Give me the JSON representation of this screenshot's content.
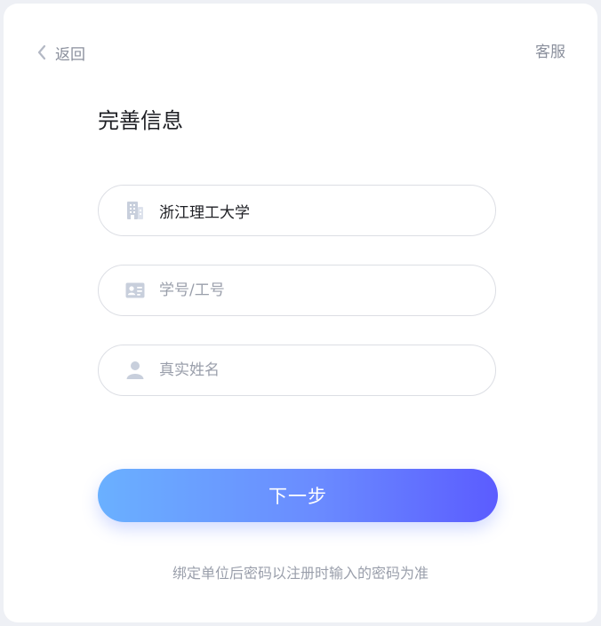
{
  "header": {
    "back_label": "返回",
    "service_label": "客服"
  },
  "page": {
    "title": "完善信息"
  },
  "form": {
    "school": {
      "value": "浙江理工大学",
      "placeholder": "",
      "icon": "building-icon"
    },
    "student_id": {
      "value": "",
      "placeholder": "学号/工号",
      "icon": "id-card-icon"
    },
    "real_name": {
      "value": "",
      "placeholder": "真实姓名",
      "icon": "user-icon"
    }
  },
  "actions": {
    "next_label": "下一步"
  },
  "footer": {
    "hint": "绑定单位后密码以注册时输入的密码为准"
  },
  "colors": {
    "icon": "#c8cfdc",
    "accent_start": "#6ab0ff",
    "accent_end": "#5b5cff",
    "muted_text": "#9a9fab"
  }
}
